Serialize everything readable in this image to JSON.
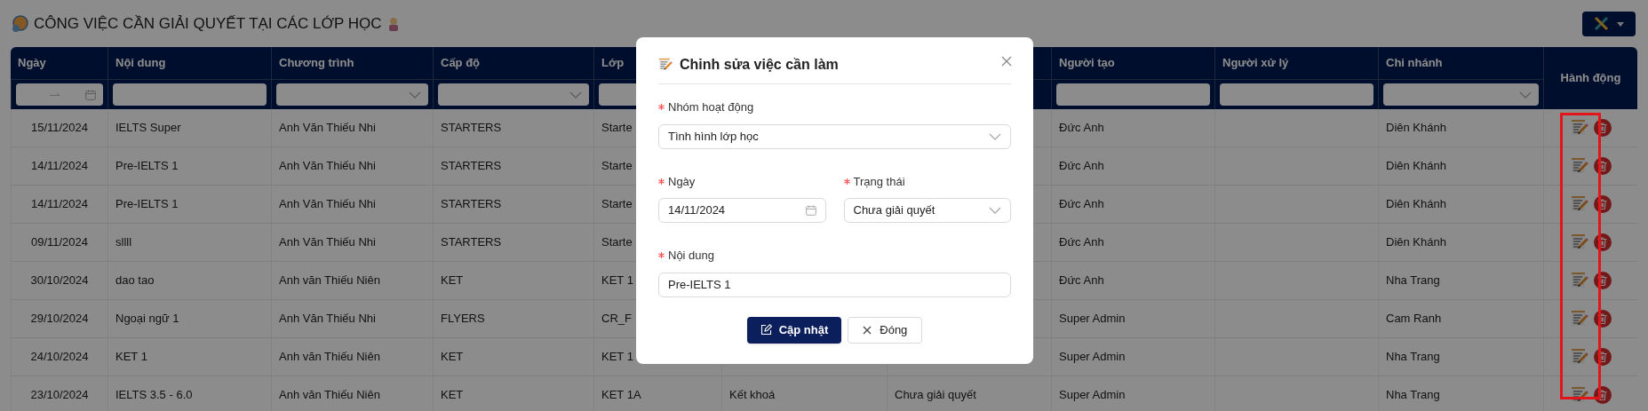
{
  "page": {
    "title": "CÔNG VIỆC CẦN GIẢI QUYẾT TẠI CÁC LỚP HỌC"
  },
  "table": {
    "columns": [
      {
        "label": "Ngày",
        "kind": "date_range"
      },
      {
        "label": "Nội dung",
        "kind": "text"
      },
      {
        "label": "Chương trình",
        "kind": "select"
      },
      {
        "label": "Cấp độ",
        "kind": "select"
      },
      {
        "label": "Lớp",
        "kind": "text"
      },
      {},
      {},
      {
        "label": "Người tạo",
        "kind": "text"
      },
      {
        "label": "Người xử lý",
        "kind": "text"
      },
      {
        "label": "Chi nhánh",
        "kind": "select"
      },
      {
        "label": "Hành động"
      }
    ],
    "rows": [
      {
        "cells": [
          "15/11/2024",
          "IELTS Super",
          "Anh Văn Thiếu Nhi",
          "STARTERS",
          "Starte",
          null,
          null,
          "Đức Anh",
          null,
          "Diên Khánh"
        ]
      },
      {
        "cells": [
          "14/11/2024",
          "Pre-IELTS 1",
          "Anh Văn Thiếu Nhi",
          "STARTERS",
          "Starte",
          null,
          null,
          "Đức Anh",
          null,
          "Diên Khánh"
        ]
      },
      {
        "cells": [
          "14/11/2024",
          "Pre-IELTS 1",
          "Anh Văn Thiếu Nhi",
          "STARTERS",
          "Starte",
          null,
          null,
          "Đức Anh",
          null,
          "Diên Khánh"
        ]
      },
      {
        "cells": [
          "09/11/2024",
          "sllll",
          "Anh Văn Thiếu Nhi",
          "STARTERS",
          "Starte",
          null,
          null,
          "Đức Anh",
          null,
          "Diên Khánh"
        ]
      },
      {
        "cells": [
          "30/10/2024",
          "dao tao",
          "Anh văn Thiếu Niên",
          "KET",
          "KET 1",
          null,
          null,
          "Đức Anh",
          null,
          "Nha Trang"
        ]
      },
      {
        "cells": [
          "29/10/2024",
          "Ngoại ngữ 1",
          "Anh Văn Thiếu Nhi",
          "FLYERS",
          "CR_F",
          null,
          null,
          "Super Admin",
          null,
          "Cam Ranh"
        ]
      },
      {
        "cells": [
          "24/10/2024",
          "KET 1",
          "Anh văn Thiếu Niên",
          "KET",
          "KET 1",
          null,
          null,
          "Super Admin",
          null,
          "Nha Trang"
        ]
      },
      {
        "cells": [
          "23/10/2024",
          "IELTS 3.5 - 6.0",
          "Anh văn Thiếu Niên",
          "KET",
          "KET 1A",
          "Kết khoá",
          "Chưa giải quyết",
          "Super Admin",
          null,
          "Nha Trang"
        ]
      }
    ]
  },
  "modal": {
    "title": "Chỉnh sửa việc cần làm",
    "rows": [
      [
        {
          "kind": "select",
          "label": "Nhóm hoạt động",
          "required": true,
          "value": "Tình hình lớp học"
        }
      ],
      [
        {
          "kind": "date",
          "label": "Ngày",
          "required": true,
          "value": "14/11/2024"
        },
        {
          "kind": "select",
          "label": "Trạng thái",
          "required": true,
          "value": "Chưa giải quyết"
        }
      ],
      [
        {
          "kind": "text",
          "label": "Nội dung",
          "required": true,
          "value": "Pre-IELTS 1"
        }
      ]
    ],
    "buttons": [
      {
        "label": "Cập nhật",
        "kind": "primary"
      },
      {
        "label": "Đóng",
        "kind": "close"
      }
    ]
  }
}
